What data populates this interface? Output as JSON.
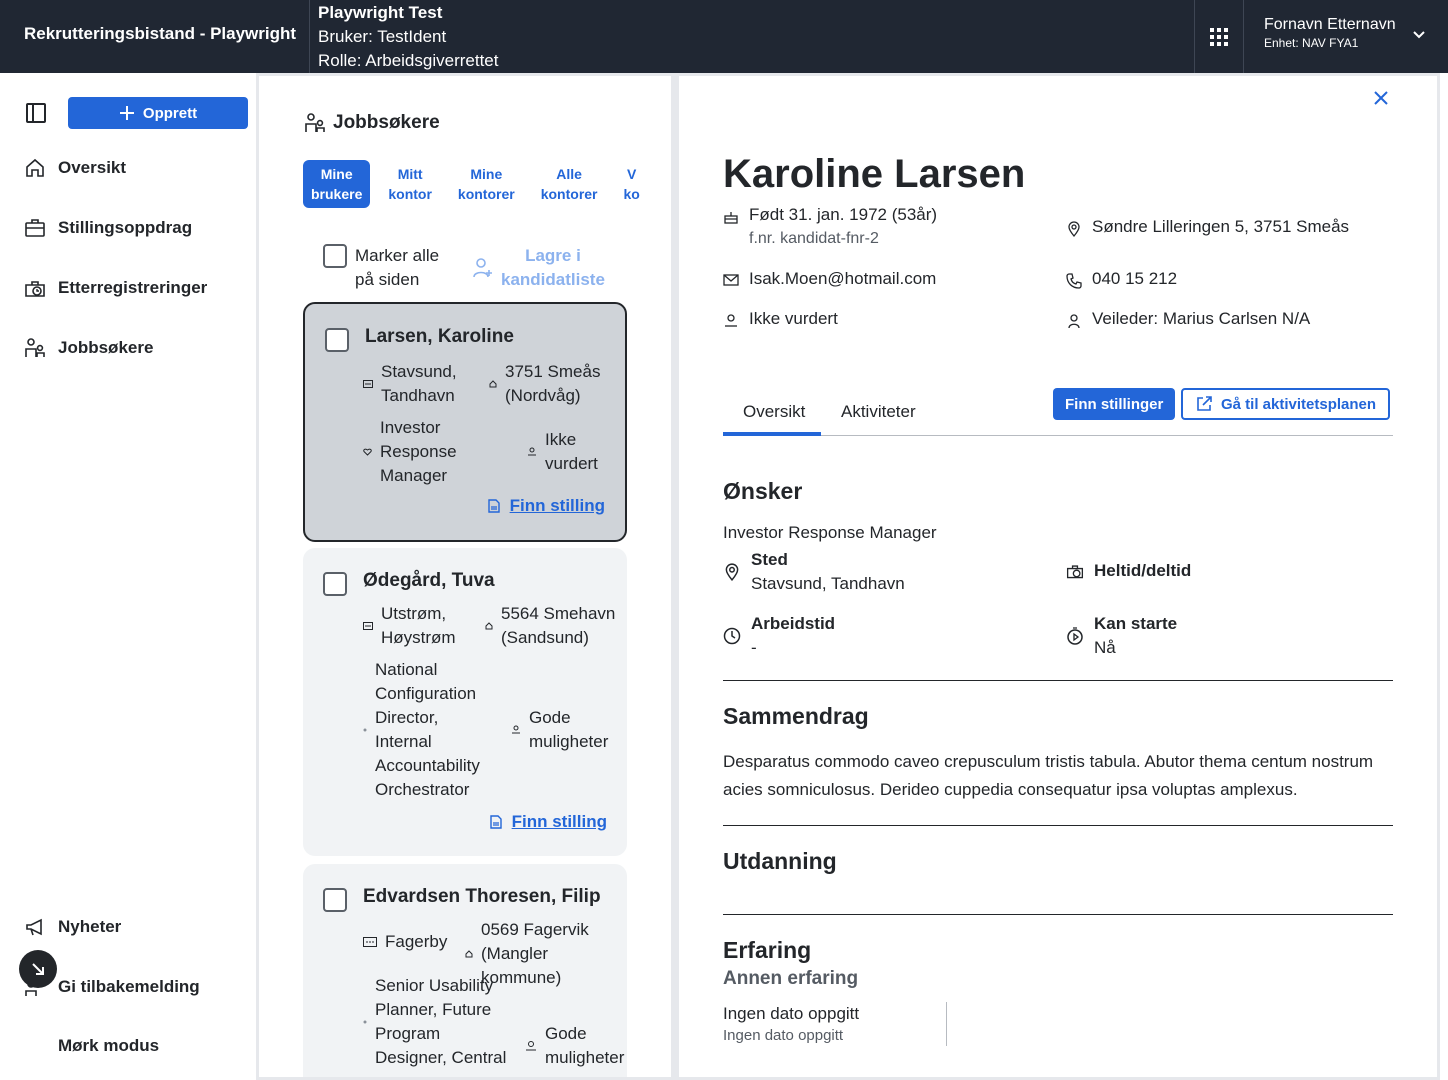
{
  "header": {
    "app_title": "Rekrutteringsbistand - Playwright",
    "env_title": "Playwright Test",
    "env_user": "Bruker: TestIdent",
    "env_role": "Rolle: Arbeidsgiverrettet",
    "user_name": "Fornavn Etternavn",
    "user_unit": "Enhet: NAV FYA1"
  },
  "sidebar": {
    "create_label": "Opprett",
    "items": [
      {
        "label": "Oversikt",
        "icon": "home-icon"
      },
      {
        "label": "Stillingsoppdrag",
        "icon": "briefcase-icon"
      },
      {
        "label": "Etterregistreringer",
        "icon": "briefcase-clock-icon"
      },
      {
        "label": "Jobbsøkere",
        "icon": "people-icon"
      }
    ],
    "bottom_items": [
      {
        "label": "Nyheter",
        "icon": "megaphone-icon"
      },
      {
        "label": "Gi tilbakemelding",
        "icon": "feedback-icon"
      },
      {
        "label": "Mørk modus",
        "icon": "moon-icon"
      }
    ]
  },
  "list": {
    "heading": "Jobbsøkere",
    "filters": [
      {
        "line1": "Mine",
        "line2": "brukere",
        "active": true
      },
      {
        "line1": "Mitt",
        "line2": "kontor",
        "active": false
      },
      {
        "line1": "Mine",
        "line2": "kontorer",
        "active": false
      },
      {
        "line1": "Alle",
        "line2": "kontorer",
        "active": false
      },
      {
        "line1": "V",
        "line2": "ko",
        "active": false
      }
    ],
    "mark_all_l1": "Marker alle",
    "mark_all_l2": "på siden",
    "save_l1": "Lagre i",
    "save_l2": "kandidatliste",
    "candidates": [
      {
        "name": "Larsen, Karoline",
        "place_l1": "Stavsund,",
        "place_l2": "Tandhavn",
        "addr_l1": "3751 Smeås",
        "addr_l2": "(Nordvåg)",
        "job_lines": [
          "Investor",
          "Response",
          "Manager"
        ],
        "status_l1": "Ikke",
        "status_l2": "vurdert",
        "link": "Finn stilling"
      },
      {
        "name": "Ødegård, Tuva",
        "place_l1": "Utstrøm,",
        "place_l2": "Høystrøm",
        "addr_l1": "5564 Smehavn",
        "addr_l2": "(Sandsund)",
        "job_lines": [
          "National",
          "Configuration",
          "Director,",
          "Internal",
          "Accountability",
          "Orchestrator"
        ],
        "status_l1": "Gode",
        "status_l2": "muligheter",
        "link": "Finn stilling"
      },
      {
        "name": "Edvardsen Thoresen, Filip",
        "place_l1": "Fagerby",
        "place_l2": "",
        "addr_l1": "0569 Fagervik",
        "addr_l2": "(Mangler kommune)",
        "job_lines": [
          "Senior Usability",
          "Planner, Future",
          "Program",
          "Designer, Central"
        ],
        "status_l1": "Gode",
        "status_l2": "muligheter"
      }
    ]
  },
  "detail": {
    "name": "Karoline Larsen",
    "born": "Født 31. jan. 1972 (53år)",
    "fnr": "f.nr. kandidat-fnr-2",
    "address": "Søndre Lilleringen 5, 3751 Smeås",
    "email": "Isak.Moen@hotmail.com",
    "phone": "040 15 212",
    "status": "Ikke vurdert",
    "veileder": "Veileder: Marius Carlsen N/A",
    "tabs": [
      "Oversikt",
      "Aktiviteter"
    ],
    "btn_find": "Finn stillinger",
    "btn_plan": "Gå til aktivitetsplanen",
    "onsker_title": "Ønsker",
    "onsker_job": "Investor Response Manager",
    "sted_label": "Sted",
    "sted_value": "Stavsund, Tandhavn",
    "heltid_label": "Heltid/deltid",
    "arbeidstid_label": "Arbeidstid",
    "arbeidstid_value": "-",
    "kanstarte_label": "Kan starte",
    "kanstarte_value": "Nå",
    "sammendrag_title": "Sammendrag",
    "sammendrag_text": "Desparatus commodo caveo crepusculum tristis tabula. Abutor thema centum nostrum acies somniculosus. Derideo cuppedia consequatur ipsa voluptas amplexus.",
    "utdanning_title": "Utdanning",
    "erfaring_title": "Erfaring",
    "annen_title": "Annen erfaring",
    "exp_date": "Ingen dato oppgitt",
    "exp_sub": "Ingen dato oppgitt"
  },
  "colors": {
    "header_bg": "#202733",
    "accent": "#2366d8",
    "selected_card": "#cfd3d8",
    "card_bg": "#f1f3f5"
  }
}
